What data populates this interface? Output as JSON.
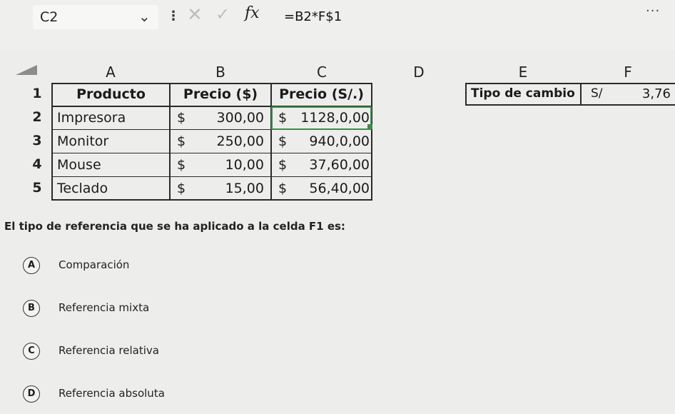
{
  "formula_bar": {
    "name_box": "C2",
    "cancel_icon": "x-icon",
    "enter_icon": "check-icon",
    "fx_label": "fx",
    "formula": "=B2*F$1",
    "more": "..."
  },
  "columns": [
    "A",
    "B",
    "C",
    "D",
    "E",
    "F"
  ],
  "rows": [
    "1",
    "2",
    "3",
    "4",
    "5"
  ],
  "table": {
    "headers": [
      "Producto",
      "Precio ($)",
      "Precio (S/.)"
    ],
    "rows": [
      {
        "producto": "Impresora",
        "usd_symbol": "$",
        "usd": "300,00",
        "pen_symbol": "$",
        "pen": "1128,0,00"
      },
      {
        "producto": "Monitor",
        "usd_symbol": "$",
        "usd": "250,00",
        "pen_symbol": "$",
        "pen": "940,0,00"
      },
      {
        "producto": "Mouse",
        "usd_symbol": "$",
        "usd": "10,00",
        "pen_symbol": "$",
        "pen": "37,60,00"
      },
      {
        "producto": "Teclado",
        "usd_symbol": "$",
        "usd": "15,00",
        "pen_symbol": "$",
        "pen": "56,40,00"
      }
    ]
  },
  "exchange": {
    "label": "Tipo de cambio",
    "currency": "S/",
    "value": "3,76"
  },
  "question": "El tipo de referencia que se ha aplicado a la celda F1 es:",
  "options": [
    {
      "letter": "A",
      "text": "Comparación"
    },
    {
      "letter": "B",
      "text": "Referencia mixta"
    },
    {
      "letter": "C",
      "text": "Referencia relativa"
    },
    {
      "letter": "D",
      "text": "Referencia absoluta"
    }
  ]
}
